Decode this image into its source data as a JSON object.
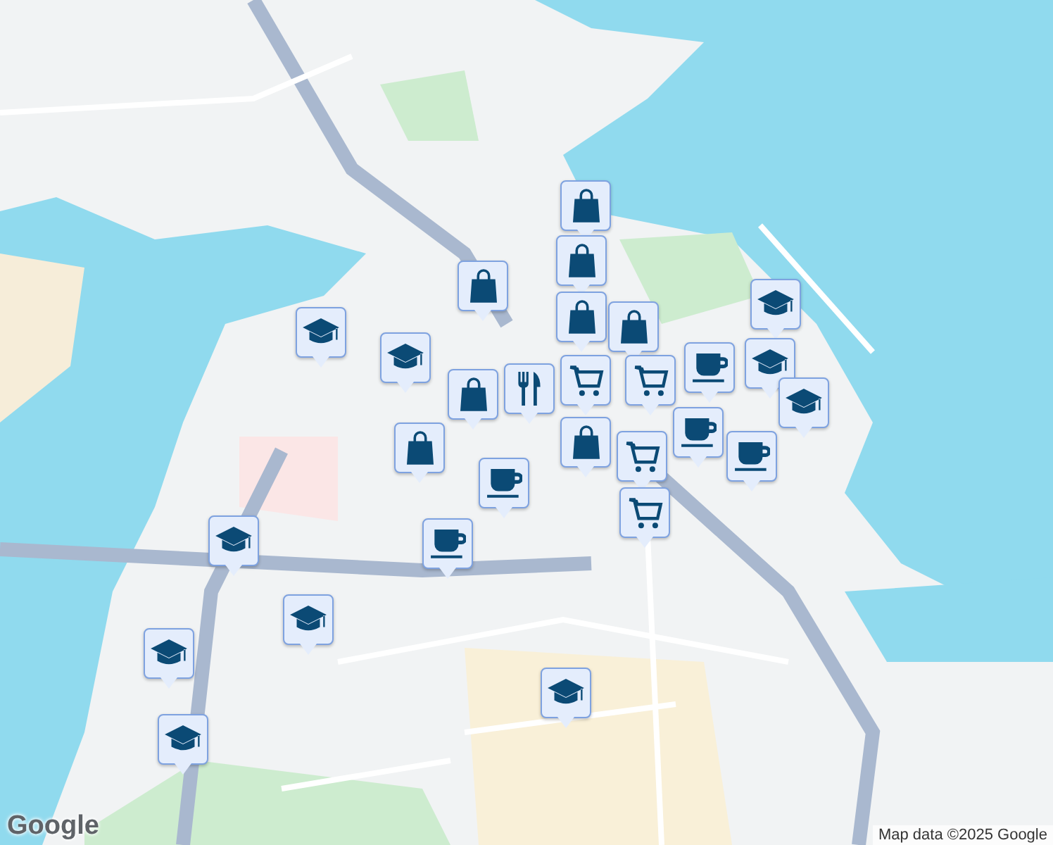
{
  "markers": [
    {
      "kind": "school"
    },
    {
      "kind": "school"
    },
    {
      "kind": "school"
    },
    {
      "kind": "school"
    },
    {
      "kind": "school"
    },
    {
      "kind": "school"
    },
    {
      "kind": "school"
    },
    {
      "kind": "school"
    },
    {
      "kind": "school"
    },
    {
      "kind": "school"
    },
    {
      "kind": "shopping"
    },
    {
      "kind": "shopping"
    },
    {
      "kind": "shopping"
    },
    {
      "kind": "shopping"
    },
    {
      "kind": "shopping"
    },
    {
      "kind": "shopping"
    },
    {
      "kind": "shopping"
    },
    {
      "kind": "shopping"
    },
    {
      "kind": "restaurant"
    },
    {
      "kind": "grocery"
    },
    {
      "kind": "grocery"
    },
    {
      "kind": "grocery"
    },
    {
      "kind": "grocery"
    },
    {
      "kind": "cafe"
    },
    {
      "kind": "cafe"
    },
    {
      "kind": "cafe"
    },
    {
      "kind": "cafe"
    },
    {
      "kind": "cafe"
    }
  ],
  "logo": "Google",
  "attribution": "Map data ©2025 Google"
}
